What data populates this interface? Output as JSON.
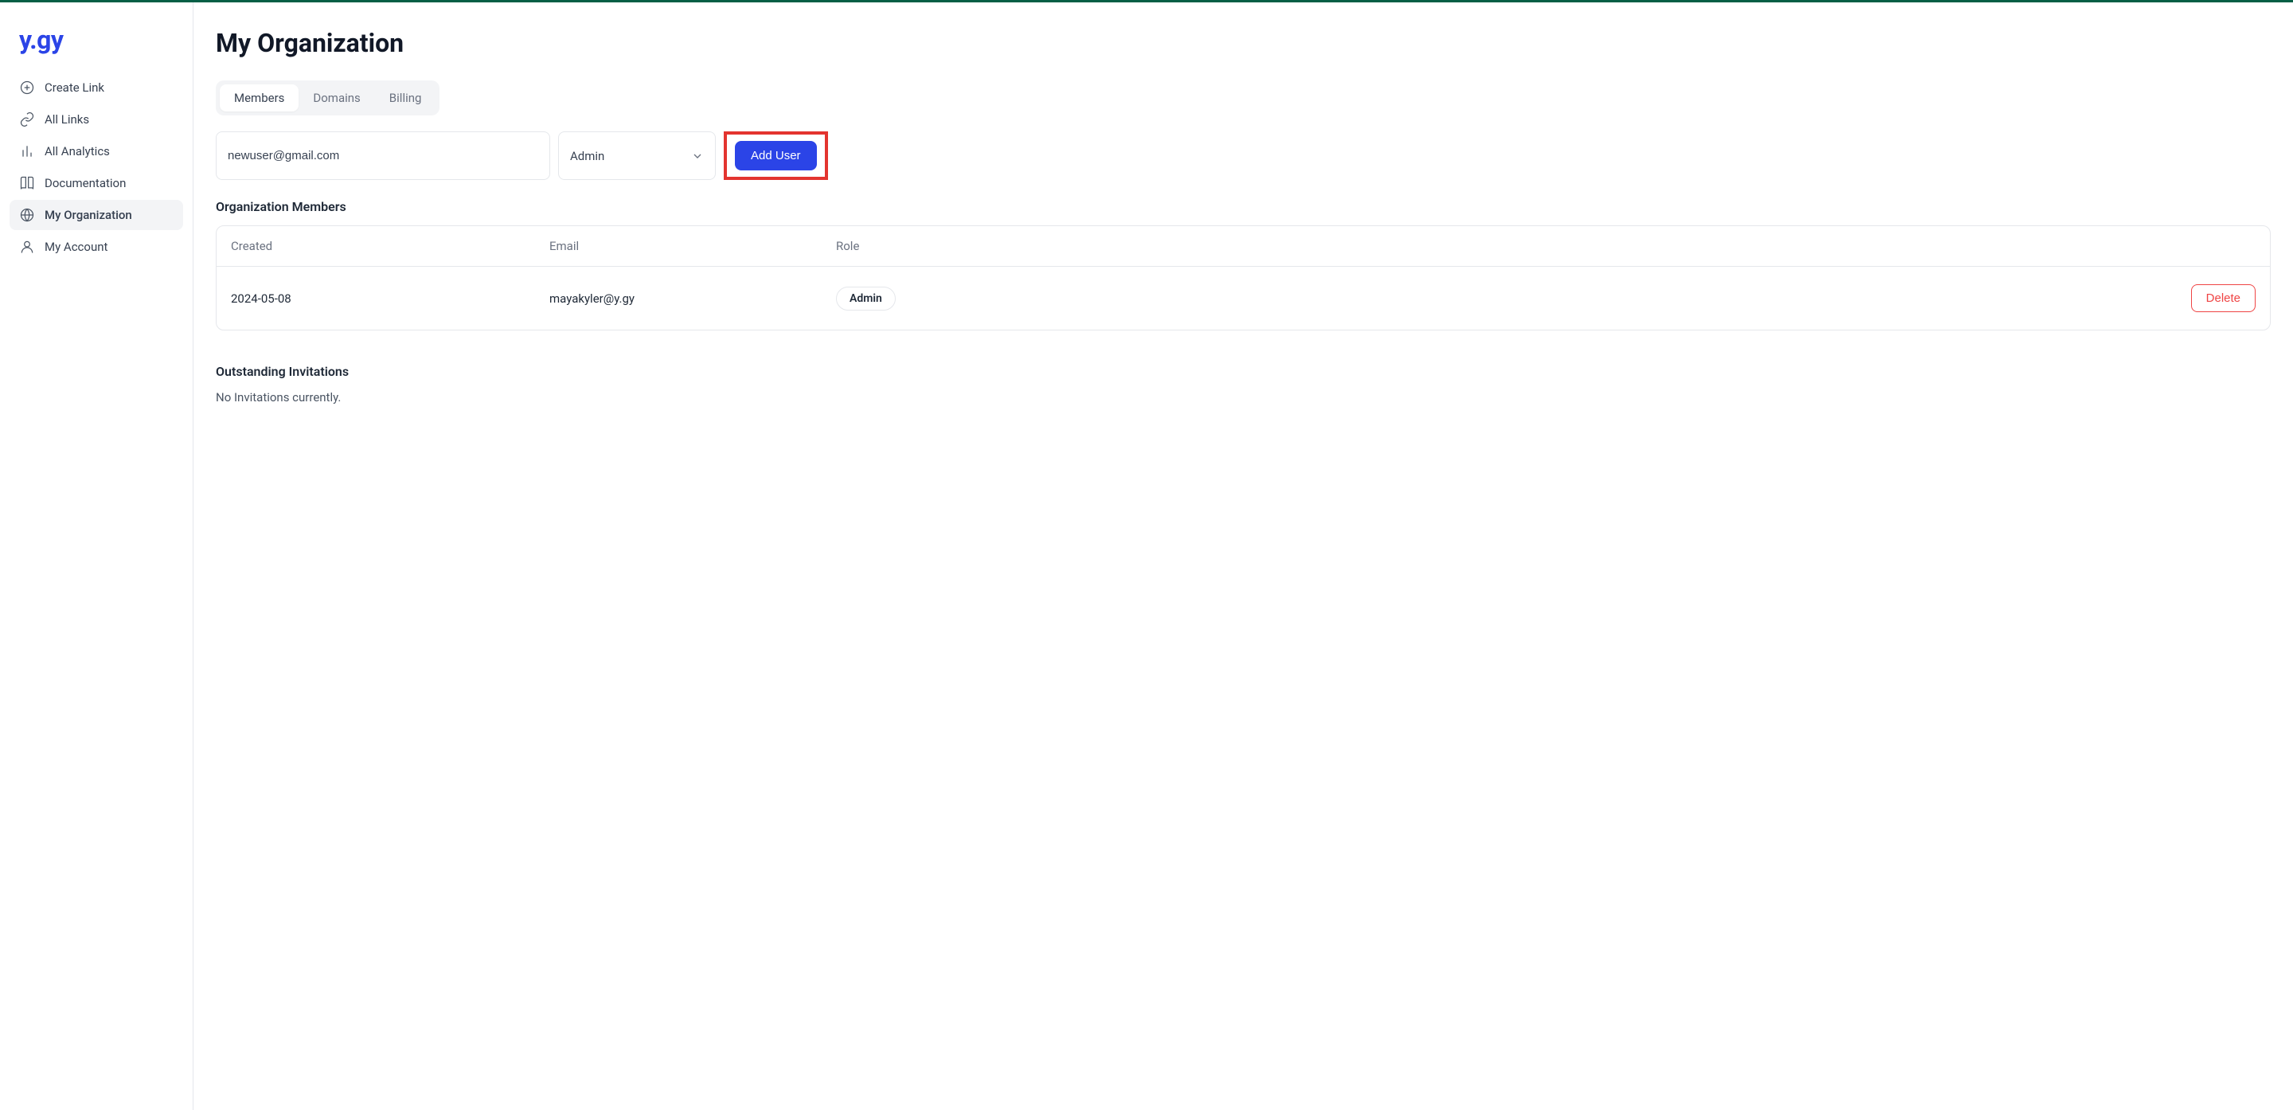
{
  "brand": "y.gy",
  "sidebar": {
    "items": [
      {
        "label": "Create Link",
        "icon": "plus-circle-icon",
        "active": false
      },
      {
        "label": "All Links",
        "icon": "link-icon",
        "active": false
      },
      {
        "label": "All Analytics",
        "icon": "bar-chart-icon",
        "active": false
      },
      {
        "label": "Documentation",
        "icon": "book-icon",
        "active": false
      },
      {
        "label": "My Organization",
        "icon": "globe-icon",
        "active": true
      },
      {
        "label": "My Account",
        "icon": "user-icon",
        "active": false
      }
    ]
  },
  "page": {
    "title": "My Organization"
  },
  "tabs": [
    {
      "label": "Members",
      "active": true
    },
    {
      "label": "Domains",
      "active": false
    },
    {
      "label": "Billing",
      "active": false
    }
  ],
  "addForm": {
    "emailValue": "newuser@gmail.com",
    "roleSelected": "Admin",
    "buttonLabel": "Add User"
  },
  "membersSection": {
    "title": "Organization Members",
    "columns": {
      "created": "Created",
      "email": "Email",
      "role": "Role"
    },
    "rows": [
      {
        "created": "2024-05-08",
        "email": "mayakyler@y.gy",
        "role": "Admin",
        "deleteLabel": "Delete"
      }
    ]
  },
  "invitationsSection": {
    "title": "Outstanding Invitations",
    "emptyText": "No Invitations currently."
  }
}
